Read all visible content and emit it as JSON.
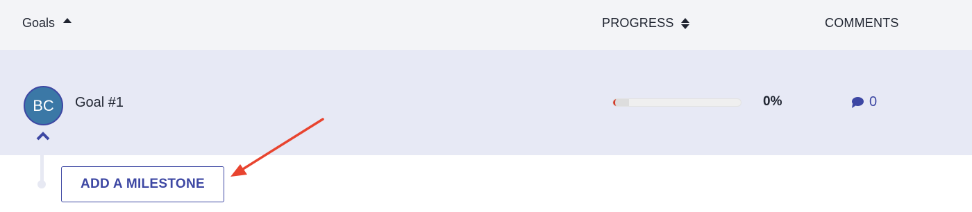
{
  "header": {
    "goals_label": "Goals",
    "progress_label": "PROGRESS",
    "comments_label": "COMMENTS"
  },
  "goal": {
    "avatar_initials": "BC",
    "name": "Goal #1",
    "progress_fraction": 0,
    "progress_text": "0%",
    "comment_count": "0"
  },
  "milestone": {
    "button_label": "ADD A MILESTONE"
  },
  "colors": {
    "header_bg": "#f3f4f7",
    "row_bg": "#e7e9f5",
    "accent": "#3d47a3",
    "avatar_bg": "#3b78a6",
    "annotation_arrow": "#e8442f",
    "progress_start": "#d23a2a"
  }
}
